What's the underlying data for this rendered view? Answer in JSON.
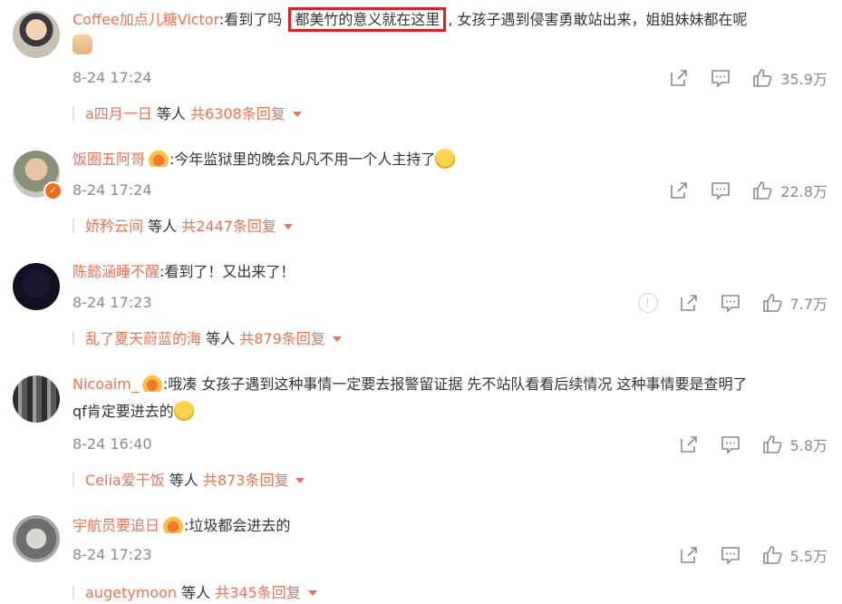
{
  "comments": [
    {
      "username": "Coffee加点儿糖Victor",
      "text_before": ":看到了吗 ",
      "highlight": "都美竹的意义就在这里",
      "text_after": ", 女孩子遇到侵害勇敢站出来，姐姐妹妹都在呢",
      "emoji": "thumbs-up-emoji",
      "date": "8-24 17:24",
      "likes": "35.9万",
      "reply_user": "a四月一日",
      "reply_mid": " 等人 ",
      "reply_total": "共6308条回复"
    },
    {
      "username": "饭圈五阿哥",
      "text_before": ":今年监狱里的晚会凡凡不用一个人主持了",
      "emoji": "crying-emoji",
      "date": "8-24 17:24",
      "likes": "22.8万",
      "reply_user": "娇矜云间",
      "reply_mid": " 等人 ",
      "reply_total": "共2447条回复"
    },
    {
      "username": "陈懿涵睡不醒",
      "text_before": ":看到了！又出来了！",
      "date": "8-24 17:23",
      "likes": "7.7万",
      "reply_user": "乱了夏天蔚蓝的海",
      "reply_mid": " 等人 ",
      "reply_total": "共879条回复"
    },
    {
      "username": "Nicoaim_",
      "text_before": ":哦凑 女孩子遇到这种事情一定要去报警留证据 先不站队看看后续情况 这种事情要是查明了",
      "text_line2": "qf肯定要进去的",
      "emoji": "shrug-emoji",
      "date": "8-24 16:40",
      "likes": "5.8万",
      "reply_user": "Celia爱干饭",
      "reply_mid": " 等人 ",
      "reply_total": "共873条回复"
    },
    {
      "username": "宇航员要追日",
      "text_before": ":垃圾都会进去的",
      "date": "8-24 17:23",
      "likes": "5.5万",
      "reply_user": "augetymoon",
      "reply_mid": " 等人 ",
      "reply_total": "共345条回复"
    }
  ],
  "icons": {
    "share": "share-icon",
    "comment": "comment-icon",
    "like": "like-icon",
    "report": "report-icon",
    "expand": "triangle-down-icon",
    "verified": "verified-badge-icon",
    "member": "crown-icon"
  },
  "colors": {
    "username": "#eb7350",
    "highlight_border": "#e01e1e",
    "meta": "#8a8a8a"
  }
}
